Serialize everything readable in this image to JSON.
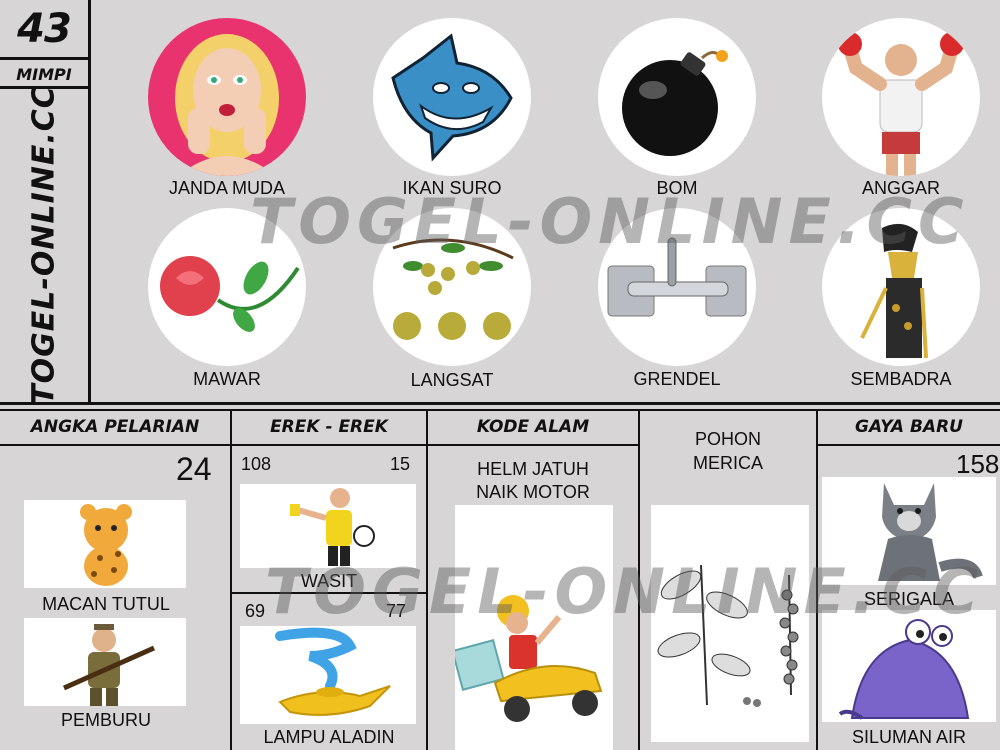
{
  "badge": {
    "number": "43",
    "label": "MIMPI"
  },
  "site": "TOGEL-ONLINE.CC",
  "watermark": "TOGEL-ONLINE.CC",
  "main_items": [
    {
      "label": "JANDA MUDA",
      "icon": "woman-face-icon"
    },
    {
      "label": "IKAN SURO",
      "icon": "shark-icon"
    },
    {
      "label": "BOM",
      "icon": "bomb-icon"
    },
    {
      "label": "ANGGAR",
      "icon": "boxer-icon"
    },
    {
      "label": "MAWAR",
      "icon": "rose-icon"
    },
    {
      "label": "LANGSAT",
      "icon": "langsat-fruit-icon"
    },
    {
      "label": "GRENDEL",
      "icon": "door-bolt-icon"
    },
    {
      "label": "SEMBADRA",
      "icon": "wayang-puppet-icon"
    }
  ],
  "angka_pelarian": {
    "header": "ANGKA PELARIAN",
    "number": "24",
    "items": [
      {
        "label": "MACAN TUTUL",
        "icon": "leopard-icon"
      },
      {
        "label": "PEMBURU",
        "icon": "hunter-icon"
      }
    ]
  },
  "erek_erek": {
    "header": "EREK - EREK",
    "top": {
      "left_num": "108",
      "right_num": "15",
      "label": "WASIT",
      "icon": "referee-icon"
    },
    "bottom": {
      "left_num": "69",
      "right_num": "77",
      "label": "LAMPU ALADIN",
      "icon": "magic-lamp-icon"
    }
  },
  "kode_alam": {
    "header": "KODE ALAM",
    "line1": "HELM JATUH",
    "line2": "NAIK MOTOR",
    "icon": "scooter-rider-icon"
  },
  "pohon": {
    "line1": "POHON",
    "line2": "MERICA",
    "icon": "pepper-plant-icon"
  },
  "gaya_baru": {
    "header": "GAYA BARU",
    "number": "158",
    "items": [
      {
        "label": "SERIGALA",
        "icon": "wolf-icon"
      },
      {
        "label": "SILUMAN AIR",
        "icon": "water-monster-icon"
      }
    ]
  }
}
